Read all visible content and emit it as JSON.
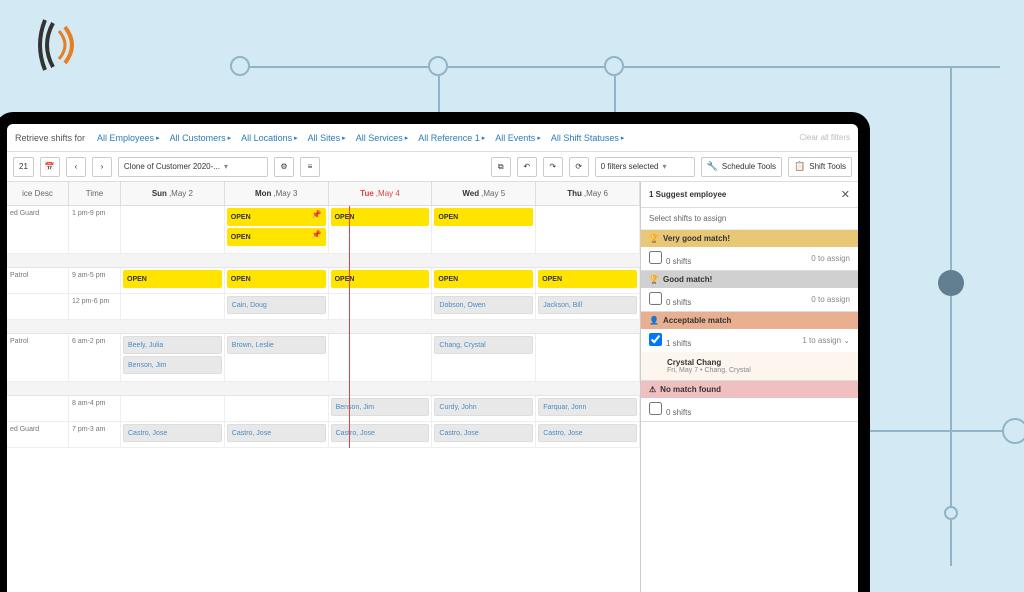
{
  "filter_bar": {
    "label": "Retrieve shifts for",
    "filters": [
      "All Employees",
      "All Customers",
      "All Locations",
      "All Sites",
      "All Services",
      "All Reference 1",
      "All Events",
      "All Shift Statuses"
    ],
    "clear": "Clear all filters"
  },
  "toolbar": {
    "date": "21",
    "view_name": "Clone of Customer 2020-...",
    "filters_selected": "0 filters selected",
    "schedule_tools": "Schedule Tools",
    "shift_tools": "Shift Tools"
  },
  "grid": {
    "headers": {
      "desc": "ice Desc",
      "time": "Time"
    },
    "days": [
      {
        "short": "Sun",
        "date": "May 2",
        "today": false
      },
      {
        "short": "Mon",
        "date": "May 3",
        "today": false
      },
      {
        "short": "Tue",
        "date": "May 4",
        "today": true
      },
      {
        "short": "Wed",
        "date": "May 5",
        "today": false
      },
      {
        "short": "Thu",
        "date": "May 6",
        "today": false
      }
    ],
    "rows": [
      {
        "desc": "ed Guard",
        "time": "1 pm-9 pm",
        "tall": true,
        "cells": [
          [],
          [
            {
              "t": "open",
              "label": "OPEN",
              "pin": true
            },
            {
              "t": "open",
              "label": "OPEN",
              "pin": true
            }
          ],
          [
            {
              "t": "open",
              "label": "OPEN"
            }
          ],
          [
            {
              "t": "open",
              "label": "OPEN"
            }
          ],
          []
        ]
      },
      {
        "desc": "",
        "time": "",
        "gap": true
      },
      {
        "desc": "Patrol",
        "time": "9 am-5 pm",
        "cells": [
          [
            {
              "t": "open",
              "label": "OPEN"
            }
          ],
          [
            {
              "t": "open",
              "label": "OPEN"
            }
          ],
          [
            {
              "t": "open",
              "label": "OPEN"
            }
          ],
          [
            {
              "t": "open",
              "label": "OPEN"
            }
          ],
          [
            {
              "t": "open",
              "label": "OPEN"
            }
          ]
        ]
      },
      {
        "desc": "",
        "time": "12 pm-6 pm",
        "cells": [
          [],
          [
            {
              "t": "assigned",
              "label": "Cain, Doug"
            }
          ],
          [],
          [
            {
              "t": "assigned",
              "label": "Dobson, Owen"
            }
          ],
          [
            {
              "t": "assigned",
              "label": "Jackson, Bill"
            }
          ]
        ]
      },
      {
        "desc": "",
        "time": "",
        "gap": true
      },
      {
        "desc": "Patrol",
        "time": "6 am-2 pm",
        "tall": true,
        "cells": [
          [
            {
              "t": "assigned",
              "label": "Beely, Julia"
            },
            {
              "t": "assigned",
              "label": "Benson, Jim"
            }
          ],
          [
            {
              "t": "assigned",
              "label": "Brown, Leslie"
            }
          ],
          [],
          [
            {
              "t": "assigned",
              "label": "Chang, Crystal"
            }
          ],
          []
        ]
      },
      {
        "desc": "",
        "time": "",
        "gap": true
      },
      {
        "desc": "",
        "time": "8 am-4 pm",
        "cells": [
          [],
          [],
          [
            {
              "t": "assigned",
              "label": "Benson, Jim"
            }
          ],
          [
            {
              "t": "assigned",
              "label": "Curdy, John"
            }
          ],
          [
            {
              "t": "assigned",
              "label": "Farquar, Jonn"
            }
          ]
        ]
      },
      {
        "desc": "ed Guard",
        "time": "7 pm-3 am",
        "cells": [
          [
            {
              "t": "assigned",
              "label": "Castro, Jose"
            }
          ],
          [
            {
              "t": "assigned",
              "label": "Castro, Jose"
            }
          ],
          [
            {
              "t": "assigned",
              "label": "Castro, Jose"
            }
          ],
          [
            {
              "t": "assigned",
              "label": "Castro, Jose"
            }
          ],
          [
            {
              "t": "assigned",
              "label": "Castro, Jose"
            }
          ]
        ]
      }
    ]
  },
  "panel": {
    "title": "1 Suggest employee",
    "subtitle": "Select shifts to assign",
    "sections": [
      {
        "kind": "very-good",
        "label": "Very good match!",
        "shifts": "0 shifts",
        "assign": "0 to assign",
        "checked": false
      },
      {
        "kind": "good",
        "label": "Good match!",
        "shifts": "0 shifts",
        "assign": "0 to assign",
        "checked": false
      },
      {
        "kind": "acceptable",
        "label": "Acceptable match",
        "shifts": "1 shifts",
        "assign": "1 to assign",
        "checked": true,
        "detail": {
          "name": "Crystal Chang",
          "sub": "Fri, May 7 • Chang, Crystal"
        }
      },
      {
        "kind": "nomatch",
        "label": "No match found",
        "shifts": "0 shifts",
        "assign": "",
        "checked": false
      }
    ]
  }
}
